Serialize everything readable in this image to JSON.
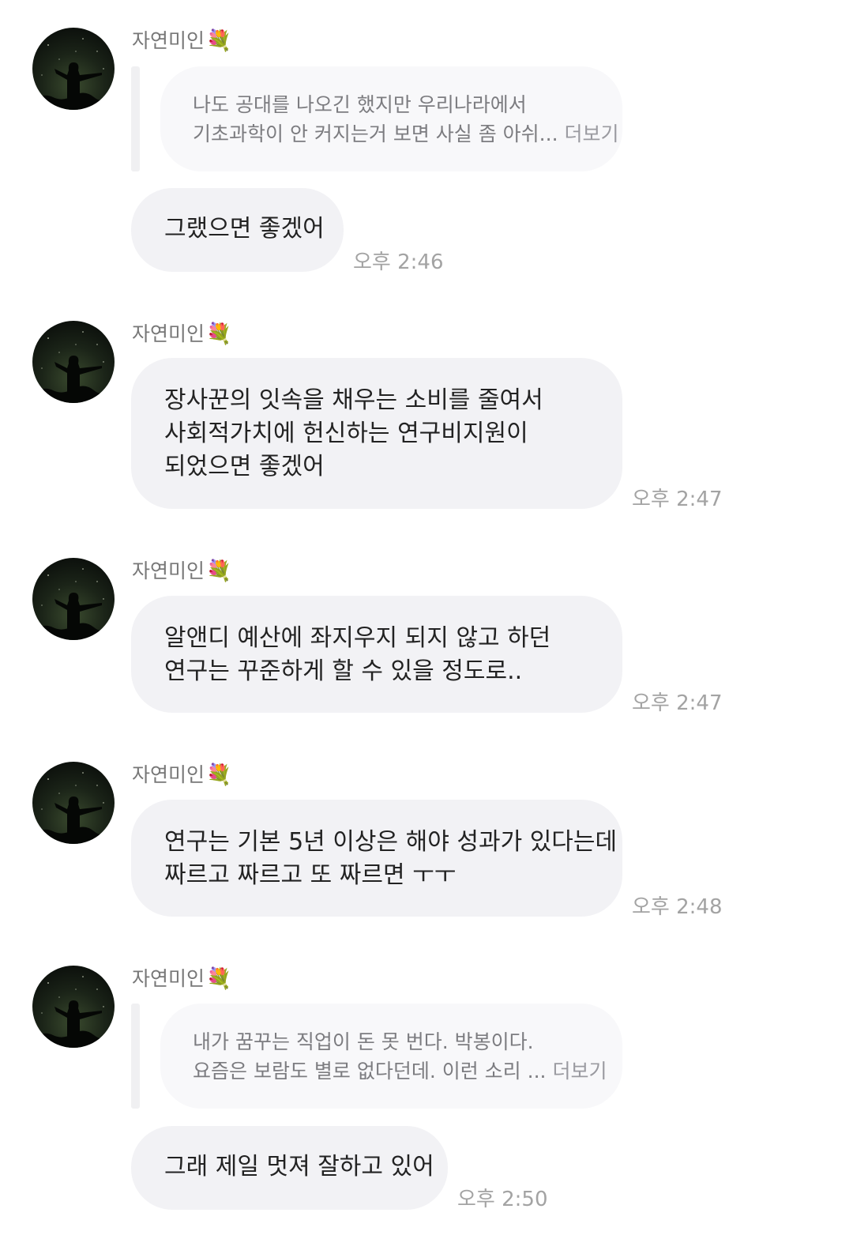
{
  "messages": [
    {
      "sender": "자연미인",
      "sender_emoji": "💐",
      "reply_line1": "나도 공대를 나오긴 했지만 우리나라에서",
      "reply_line2": "기초과학이 안 커지는거 보면 사실 좀 아쉬...",
      "reply_more": "더보기",
      "text": "그랬으면 좋겠어",
      "time": "오후 2:46"
    },
    {
      "sender": "자연미인",
      "sender_emoji": "💐",
      "text": "장사꾼의 잇속을 채우는 소비를 줄여서\n사회적가치에 헌신하는 연구비지원이\n되었으면 좋겠어",
      "time": "오후 2:47"
    },
    {
      "sender": "자연미인",
      "sender_emoji": "💐",
      "text": "알앤디 예산에 좌지우지 되지 않고 하던\n연구는 꾸준하게 할 수 있을 정도로..",
      "time": "오후 2:47"
    },
    {
      "sender": "자연미인",
      "sender_emoji": "💐",
      "text": "연구는 기본 5년 이상은 해야 성과가 있다는데\n짜르고 짜르고 또 짜르면 ㅜㅜ",
      "time": "오후 2:48"
    },
    {
      "sender": "자연미인",
      "sender_emoji": "💐",
      "reply_line1": "내가 꿈꾸는 직업이 돈 못 번다. 박봉이다.",
      "reply_line2": "요즘은 보람도 별로 없다던데. 이런 소리 ...",
      "reply_more": "더보기",
      "text": "그래 제일 멋져 잘하고 있어",
      "time": "오후 2:50"
    }
  ],
  "colors": {
    "bubble": "#f2f2f5",
    "reply_bubble": "#f8f8fa",
    "time": "#a3a3a3",
    "name": "#777777"
  },
  "icons": [
    "avatar-night-sky-silhouette",
    "bouquet-emoji"
  ]
}
